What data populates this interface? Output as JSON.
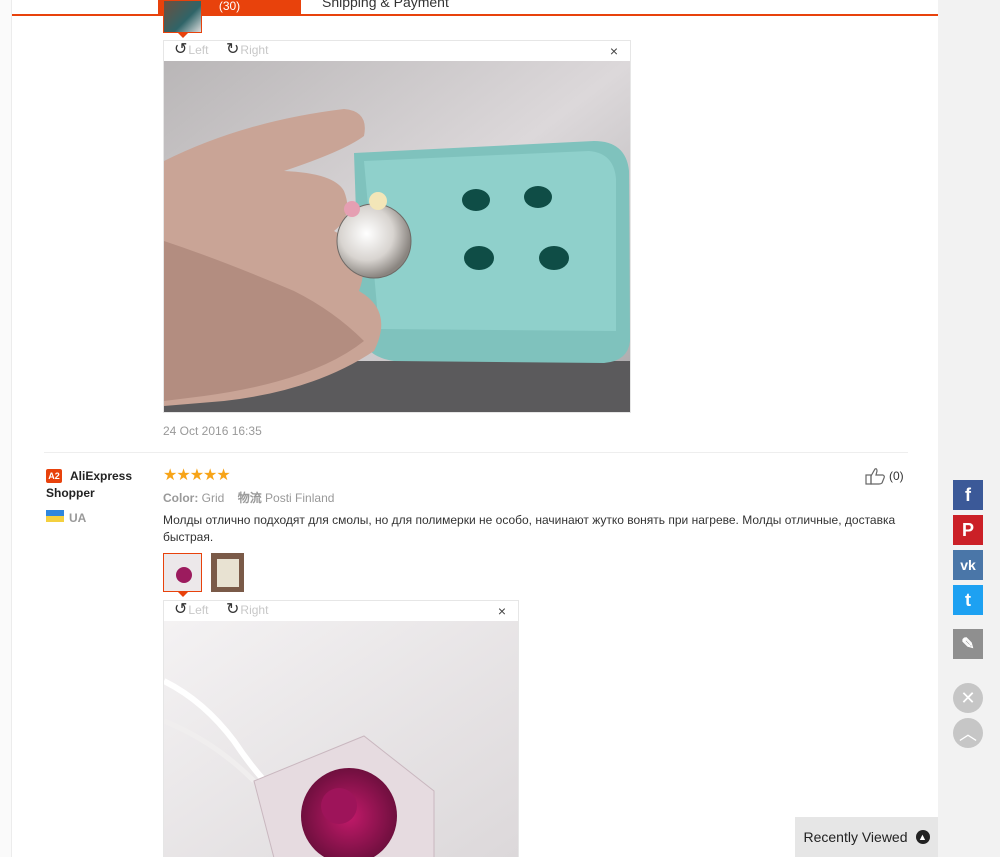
{
  "tabs": {
    "active_label": "(30)",
    "other_label": "Shipping & Payment"
  },
  "viewer1": {
    "rotate_left": "Left",
    "rotate_right": "Right",
    "close": "×"
  },
  "review1": {
    "date": "24 Oct 2016 16:35"
  },
  "review2": {
    "badge": "A2",
    "name": "AliExpress Shopper",
    "country": "UA",
    "rating": 5,
    "stars": "★★★★★",
    "color_label": "Color:",
    "color_value": "Grid",
    "logistics_label": "物流",
    "logistics_value": "Posti Finland",
    "text": "Молды отлично подходят для смолы, но для полимерки не особо, начинают жутко вонять при нагреве. Молды отличные, доставка быстрая.",
    "likes": "(0)"
  },
  "viewer2": {
    "rotate_left": "Left",
    "rotate_right": "Right",
    "close": "×"
  },
  "share": {
    "facebook": "f",
    "pinterest": "P",
    "vk": "vk",
    "twitter": "t"
  },
  "recently_viewed": "Recently Viewed",
  "colors": {
    "accent": "#e8420c",
    "facebook": "#3b5998",
    "pinterest": "#cb2027",
    "vk": "#4a76a8",
    "twitter": "#1da1f2",
    "star": "#f7a418"
  }
}
